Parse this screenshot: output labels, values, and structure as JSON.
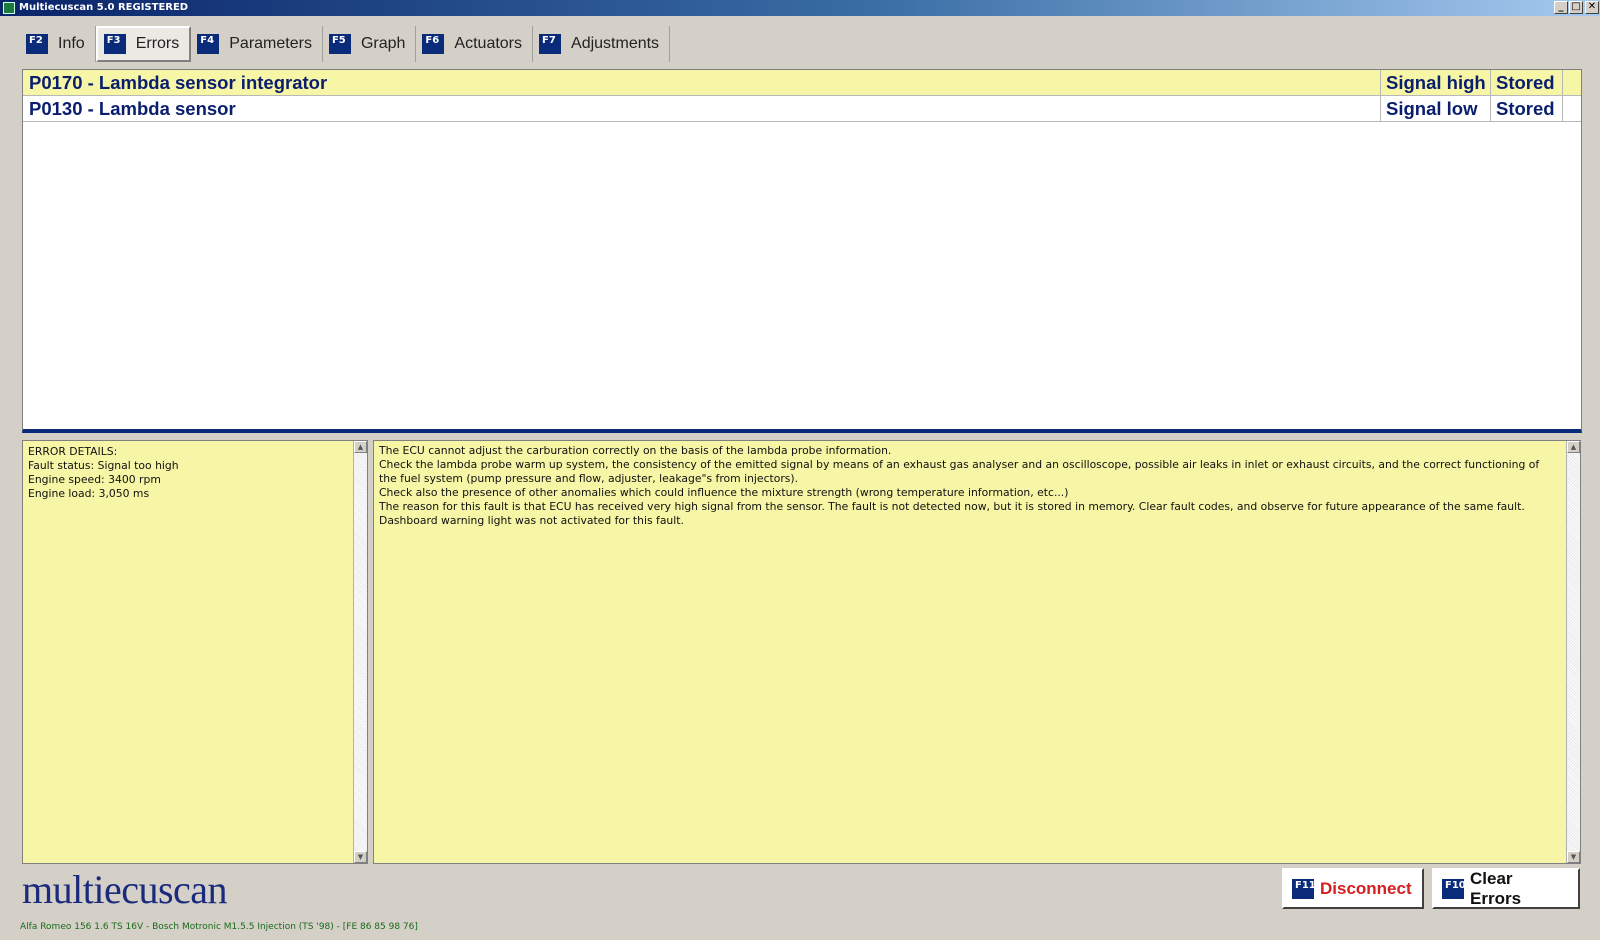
{
  "window": {
    "title": "Multiecuscan 5.0 REGISTERED"
  },
  "tabs": [
    {
      "key": "F2",
      "label": "Info",
      "active": false
    },
    {
      "key": "F3",
      "label": "Errors",
      "active": true
    },
    {
      "key": "F4",
      "label": "Parameters",
      "active": false
    },
    {
      "key": "F5",
      "label": "Graph",
      "active": false
    },
    {
      "key": "F6",
      "label": "Actuators",
      "active": false
    },
    {
      "key": "F7",
      "label": "Adjustments",
      "active": false
    }
  ],
  "errors": [
    {
      "code": "P0170 - Lambda sensor integrator",
      "signal": "Signal high",
      "state": "Stored",
      "selected": true
    },
    {
      "code": "P0130 - Lambda sensor",
      "signal": "Signal low",
      "state": "Stored",
      "selected": false
    }
  ],
  "details": {
    "heading": "ERROR DETAILS:",
    "lines": [
      "Fault status: Signal too high",
      "Engine speed: 3400 rpm",
      "Engine load: 3,050 ms"
    ]
  },
  "description": {
    "lines": [
      "The ECU cannot adjust the carburation correctly on the basis of the lambda probe information.",
      "Check the lambda probe warm up system, the consistency of the emitted signal by means of an exhaust gas analyser and an oscilloscope, possible air leaks in inlet or exhaust circuits, and the correct functioning of the fuel system (pump pressure and flow, adjuster, leakage\"s from injectors).",
      "Check also the presence of other anomalies which could influence the mixture strength (wrong temperature information, etc...)",
      "The reason for this fault is that ECU has received very high signal from the sensor. The fault is not detected now, but it is stored in memory. Clear fault codes, and observe for future appearance of the same fault.",
      "Dashboard warning light was not activated for this fault."
    ]
  },
  "footer": {
    "logo": "multiecuscan",
    "disconnect": {
      "key": "F11",
      "label": "Disconnect"
    },
    "clear": {
      "key": "F10",
      "label": "Clear Errors"
    },
    "status": "Alfa Romeo 156 1.6 TS 16V - Bosch Motronic M1.5.5 Injection (TS '98) - [FE 86 85 98 76]"
  },
  "icons": {
    "scroll_up": "▲",
    "scroll_down": "▼",
    "minimize": "_",
    "maximize": "□",
    "close": "✕"
  },
  "colors": {
    "accent": "#0a2a7a",
    "panel_yellow": "#f7f5a6",
    "disconnect_red": "#d42020",
    "status_green": "#1a6a1a"
  }
}
